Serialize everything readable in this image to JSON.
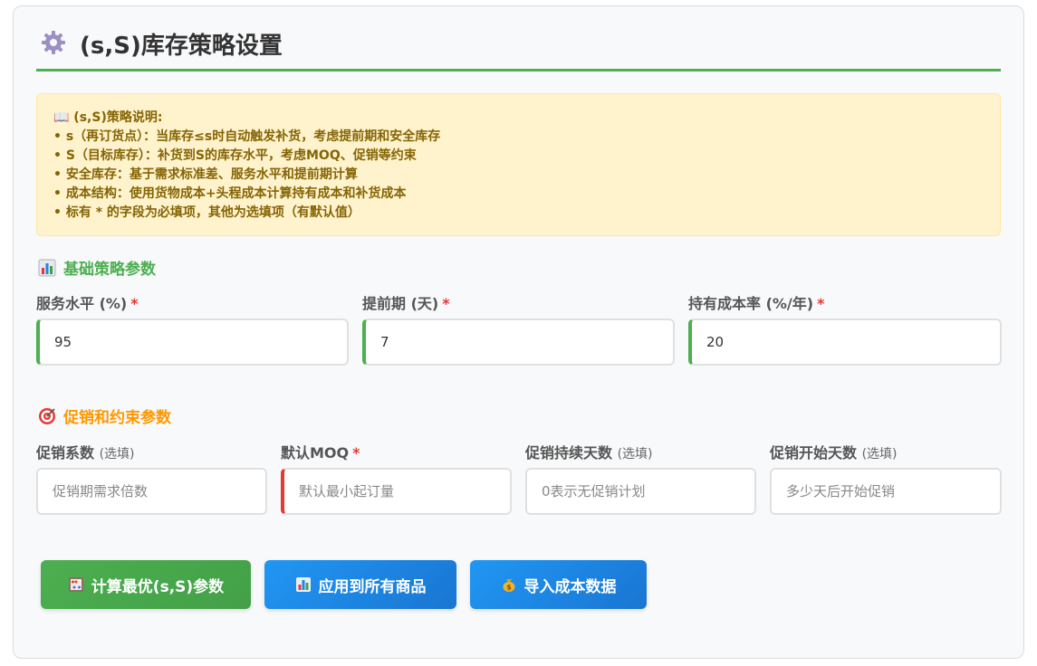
{
  "header": {
    "title": "(s,S)库存策略设置",
    "icon": "gear-icon"
  },
  "info": {
    "title": "📖 (s,S)策略说明:",
    "lines": [
      "• s（再订货点）：当库存≤s时自动触发补货，考虑提前期和安全库存",
      "• S（目标库存）：补货到S的库存水平，考虑MOQ、促销等约束",
      "• 安全库存：基于需求标准差、服务水平和提前期计算",
      "• 成本结构：使用货物成本+头程成本计算持有成本和补货成本",
      "• 标有 * 的字段为必填项，其他为选填项（有默认值）"
    ]
  },
  "basic": {
    "title": "基础策略参数",
    "icon": "bar-chart-icon",
    "fields": [
      {
        "label": "服务水平 (%)",
        "required": "*",
        "value": "95"
      },
      {
        "label": "提前期 (天)",
        "required": "*",
        "value": "7"
      },
      {
        "label": "持有成本率 (%/年)",
        "required": "*",
        "value": "20"
      }
    ]
  },
  "promo": {
    "title": "促销和约束参数",
    "icon": "target-icon",
    "fields": [
      {
        "label": "促销系数",
        "optional": "(选填)",
        "placeholder": "促销期需求倍数"
      },
      {
        "label": "默认MOQ",
        "required": "*",
        "placeholder": "默认最小起订量"
      },
      {
        "label": "促销持续天数",
        "optional": "(选填)",
        "placeholder": "0表示无促销计划"
      },
      {
        "label": "促销开始天数",
        "optional": "(选填)",
        "placeholder": "多少天后开始促销"
      }
    ]
  },
  "buttons": {
    "calculate": {
      "label": "计算最优(s,S)参数",
      "icon": "abacus-icon"
    },
    "apply_all": {
      "label": "应用到所有商品",
      "icon": "bar-chart-icon"
    },
    "import_cost": {
      "label": "导入成本数据",
      "icon": "money-bag-icon"
    }
  },
  "colors": {
    "accent_green": "#4caf50",
    "accent_orange": "#ff9800",
    "accent_blue": "#2196f3",
    "required_red": "#e53935",
    "info_bg": "#fff3cd",
    "info_text": "#856404"
  }
}
